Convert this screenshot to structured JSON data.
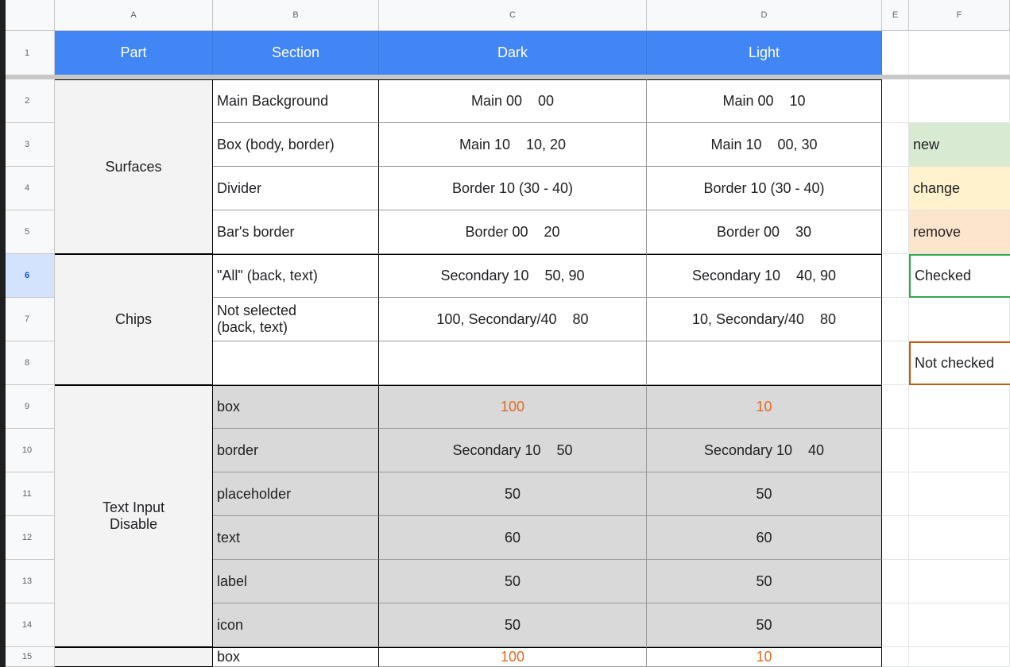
{
  "columns": [
    "A",
    "B",
    "C",
    "D",
    "E",
    "F"
  ],
  "rows": [
    "1",
    "2",
    "3",
    "4",
    "5",
    "6",
    "7",
    "8",
    "9",
    "10",
    "11",
    "12",
    "13",
    "14",
    "15"
  ],
  "selected_row": "6",
  "header": {
    "part": "Part",
    "section": "Section",
    "dark": "Dark",
    "light": "Light"
  },
  "groups": {
    "surfaces": "Surfaces",
    "chips": "Chips",
    "text_input_disable": "Text Input\nDisable"
  },
  "table": [
    {
      "section": "Main Background",
      "dark": "Main 00    00",
      "light": "Main 00    10"
    },
    {
      "section": "Box (body, border)",
      "dark": "Main 10    10, 20",
      "light": "Main 10    00, 30"
    },
    {
      "section": "Divider",
      "dark": "Border 10 (30 - 40)",
      "light": "Border 10 (30 - 40)"
    },
    {
      "section": "Bar's border",
      "dark": "Border 00    20",
      "light": "Border 00    30"
    },
    {
      "section": "\"All\" (back, text)",
      "dark": "Secondary 10    50, 90",
      "light": "Secondary 10    40, 90"
    },
    {
      "section": "Not selected\n(back, text)",
      "dark": "100, Secondary/40    80",
      "light": "10, Secondary/40    80"
    },
    {
      "section": "",
      "dark": "",
      "light": ""
    },
    {
      "section": "box",
      "dark": "100",
      "light": "10"
    },
    {
      "section": "border",
      "dark": "Secondary 10    50",
      "light": "Secondary 10    40"
    },
    {
      "section": "placeholder",
      "dark": "50",
      "light": "50"
    },
    {
      "section": "text",
      "dark": "60",
      "light": "60"
    },
    {
      "section": "label",
      "dark": "50",
      "light": "50"
    },
    {
      "section": "icon",
      "dark": "50",
      "light": "50"
    },
    {
      "section": "box",
      "dark": "100",
      "light": "10"
    }
  ],
  "legend": {
    "new": "new",
    "change": "change",
    "remove": "remove",
    "checked": "Checked",
    "not_checked": "Not checked"
  },
  "colors": {
    "header_blue": "#4285f4",
    "new_green": "#d9ead3",
    "change_yellow": "#fff2cc",
    "remove_red": "#fce5cd",
    "checked_border": "#34a853",
    "not_checked_border": "#c55a11",
    "changed_value_text": "#e06c21",
    "disabled_group_bg": "#d9d9d9"
  }
}
